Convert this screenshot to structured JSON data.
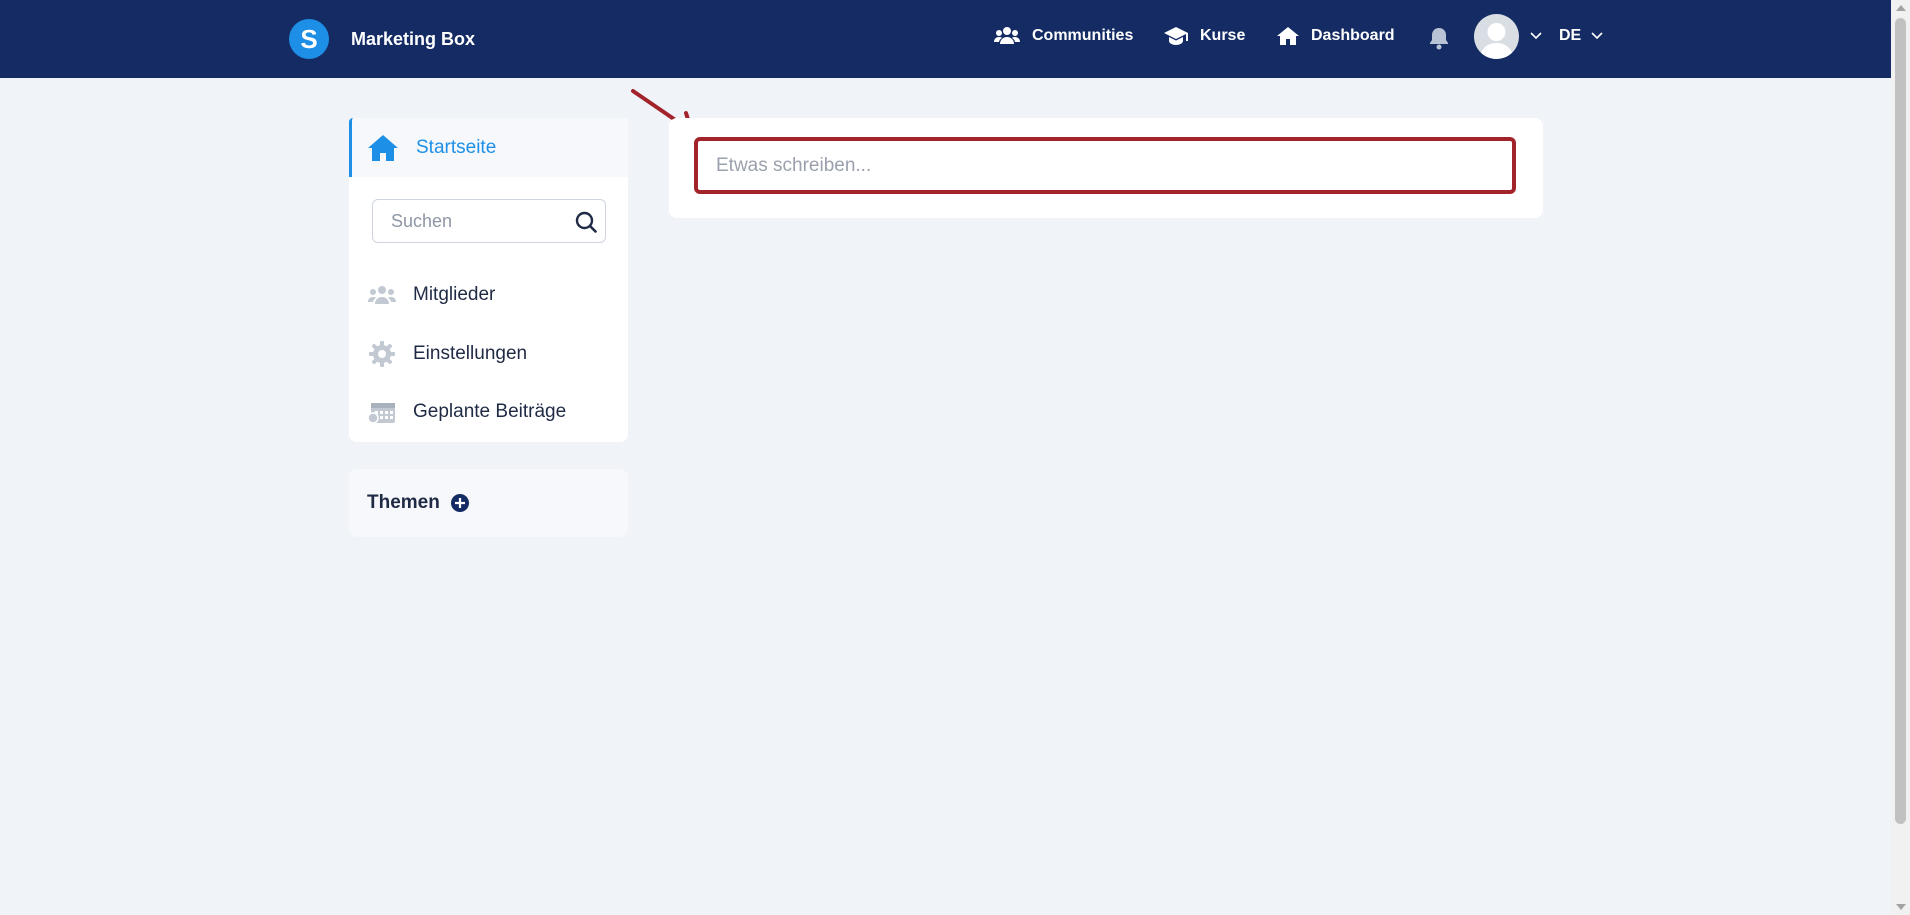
{
  "header": {
    "brand_letter": "S",
    "brand_name": "Marketing Box",
    "nav": {
      "communities": "Communities",
      "kurse": "Kurse",
      "dashboard": "Dashboard"
    },
    "language": "DE"
  },
  "sidebar": {
    "home_label": "Startseite",
    "search_placeholder": "Suchen",
    "items": [
      {
        "label": "Mitglieder",
        "icon": "members-icon"
      },
      {
        "label": "Einstellungen",
        "icon": "gear-icon"
      },
      {
        "label": "Geplante Beiträge",
        "icon": "calendar-icon"
      }
    ],
    "topics_title": "Themen"
  },
  "main": {
    "post_placeholder": "Etwas schreiben..."
  },
  "colors": {
    "header_bg": "#142c63",
    "accent": "#1e8fe6",
    "highlight": "#a3232b",
    "background": "#f0f3f8"
  }
}
